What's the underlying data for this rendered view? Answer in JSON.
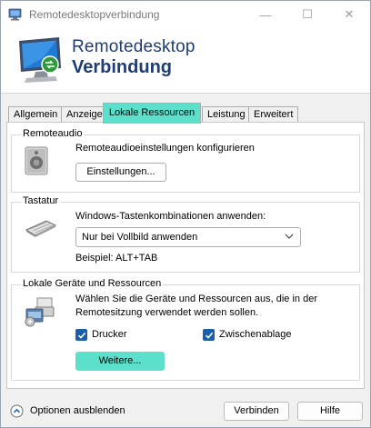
{
  "window": {
    "title": "Remotedesktopverbindung",
    "controls": {
      "minimize": "—",
      "maximize": "☐",
      "close": "✕"
    }
  },
  "banner": {
    "title_line1": "Remotedesktop",
    "title_line2": "Verbindung"
  },
  "tabs": [
    {
      "label": "Allgemein",
      "active": false
    },
    {
      "label": "Anzeige",
      "active": false
    },
    {
      "label": "Lokale Ressourcen",
      "active": true
    },
    {
      "label": "Leistung",
      "active": false
    },
    {
      "label": "Erweitert",
      "active": false
    }
  ],
  "remote_audio": {
    "group_label": "Remoteaudio",
    "description": "Remoteaudioeinstellungen konfigurieren",
    "settings_button": "Einstellungen..."
  },
  "keyboard": {
    "group_label": "Tastatur",
    "description": "Windows-Tastenkombinationen anwenden:",
    "selected_option": "Nur bei Vollbild anwenden",
    "example": "Beispiel: ALT+TAB"
  },
  "local_devices": {
    "group_label": "Lokale Geräte und Ressourcen",
    "description_line1": "Wählen Sie die Geräte und Ressourcen aus, die in der",
    "description_line2": "Remotesitzung verwendet werden sollen.",
    "printer": {
      "label": "Drucker",
      "checked": true
    },
    "clipboard": {
      "label": "Zwischenablage",
      "checked": true
    },
    "more_button": "Weitere..."
  },
  "footer": {
    "hide_options": "Optionen ausblenden",
    "connect_button": "Verbinden",
    "help_button": "Hilfe"
  },
  "colors": {
    "highlight": "#5ce0cc",
    "banner_text": "#1f3d74",
    "checkbox": "#1c5ea8"
  }
}
